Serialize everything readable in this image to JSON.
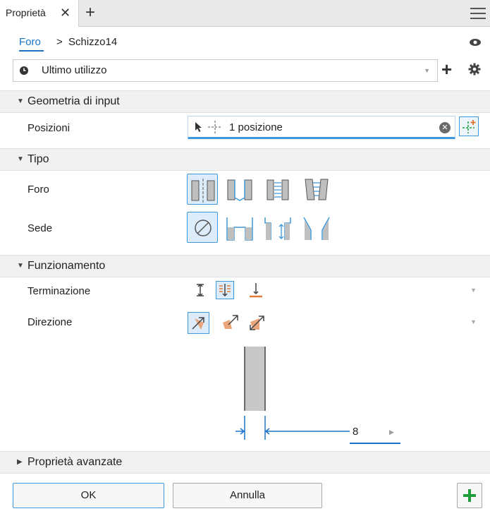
{
  "tab": {
    "label": "Proprietà"
  },
  "breadcrumb": {
    "link": "Foro",
    "separator": ">",
    "current": "Schizzo14"
  },
  "preset": {
    "value": "Ultimo utilizzo"
  },
  "sections": {
    "input_geometry": "Geometria di input",
    "type": "Tipo",
    "behavior": "Funzionamento",
    "advanced": "Proprietà avanzate"
  },
  "fields": {
    "positions_label": "Posizioni",
    "positions_value": "1 posizione",
    "hole_label": "Foro",
    "seat_label": "Sede",
    "termination_label": "Terminazione",
    "direction_label": "Direzione"
  },
  "dimension": {
    "value": "8"
  },
  "footer": {
    "ok": "OK",
    "cancel": "Annulla"
  },
  "colors": {
    "accent": "#3f98d9",
    "link": "#1a73c8",
    "orange": "#e07b39",
    "green": "#1f9d3a"
  },
  "icons": [
    "close-icon",
    "plus-icon",
    "menu-icon",
    "eye-icon",
    "clock-icon",
    "gear-icon",
    "cursor-icon",
    "point-icon",
    "clear-icon",
    "add-point-icon"
  ]
}
